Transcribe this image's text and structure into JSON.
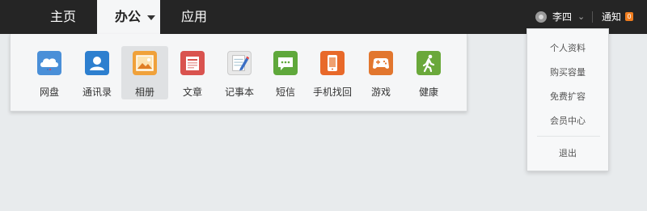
{
  "nav": {
    "home": "主页",
    "office": "办公",
    "apps": "应用"
  },
  "user": {
    "name": "李四",
    "notice_label": "通知",
    "notice_count": "0"
  },
  "office_apps": [
    {
      "label": "网盘",
      "icon": "cloud-drive-icon",
      "color": "#4a8fd8"
    },
    {
      "label": "通讯录",
      "icon": "contacts-icon",
      "color": "#2d7fcf"
    },
    {
      "label": "相册",
      "icon": "photo-album-icon",
      "color": "#f0a13a",
      "selected": true
    },
    {
      "label": "文章",
      "icon": "article-icon",
      "color": "#d9534f"
    },
    {
      "label": "记事本",
      "icon": "notepad-icon",
      "color": "#e8e8e8"
    },
    {
      "label": "短信",
      "icon": "sms-icon",
      "color": "#5fa83b"
    },
    {
      "label": "手机找回",
      "icon": "phone-finder-icon",
      "color": "#e8692a"
    },
    {
      "label": "游戏",
      "icon": "game-icon",
      "color": "#e2762e"
    },
    {
      "label": "健康",
      "icon": "health-icon",
      "color": "#6aa83a"
    }
  ],
  "user_menu": {
    "profile": "个人资料",
    "buy_storage": "购买容量",
    "free_expand": "免费扩容",
    "member_center": "会员中心",
    "logout": "退出"
  }
}
